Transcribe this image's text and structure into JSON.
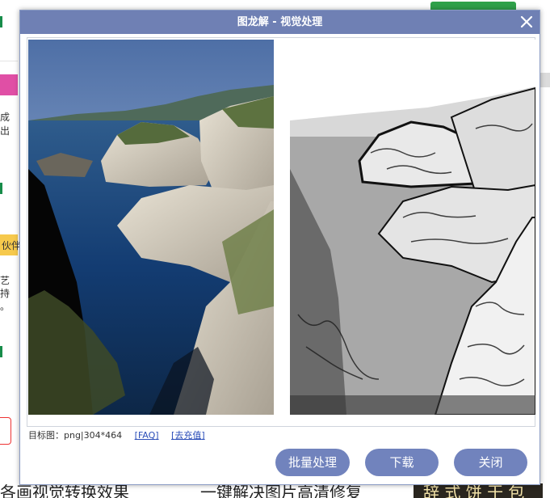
{
  "background": {
    "side_texts": [
      "成",
      "出",
      "艺",
      "持",
      "。"
    ],
    "yellow_label": "伙伴",
    "bottom_texts": [
      "各画视觉转换效果",
      "一键解决图片高清修复",
      "辞 式 饼 干 包"
    ]
  },
  "dialog": {
    "title": "图龙解 - 视觉处理",
    "close_icon": "close-icon",
    "info": {
      "target_label": "目标图：png|304*464",
      "faq_link": "FAQ",
      "recharge_link": "去充值"
    },
    "buttons": {
      "batch": "批量处理",
      "download": "下载",
      "close": "关闭"
    }
  },
  "colors": {
    "header": "#6f80b4",
    "button": "#7183bd",
    "link": "#2a4db8"
  }
}
